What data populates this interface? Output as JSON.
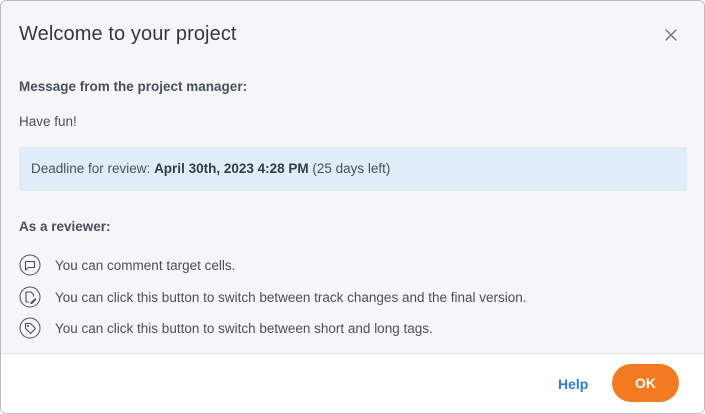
{
  "dialog": {
    "title": "Welcome to your project",
    "close_icon": "close-icon"
  },
  "message": {
    "heading": "Message from the project manager:",
    "text": "Have fun!"
  },
  "deadline": {
    "label": "Deadline for review: ",
    "date": "April 30th, 2023 4:28 PM",
    "remaining": " (25 days left)"
  },
  "reviewer": {
    "heading": "As a reviewer:",
    "features": [
      {
        "icon": "comment-icon",
        "text": "You can comment target cells."
      },
      {
        "icon": "track-changes-icon",
        "text": "You can click this button to switch between track changes and the final version."
      },
      {
        "icon": "tag-icon",
        "text": "You can click this button to switch between short and long tags."
      }
    ]
  },
  "footer": {
    "help_label": "Help",
    "ok_label": "OK"
  },
  "colors": {
    "accent": "#f47a21",
    "link": "#2b7fd8",
    "deadline_bg": "#e1ecfb",
    "body_bg": "#f6f6f9"
  }
}
